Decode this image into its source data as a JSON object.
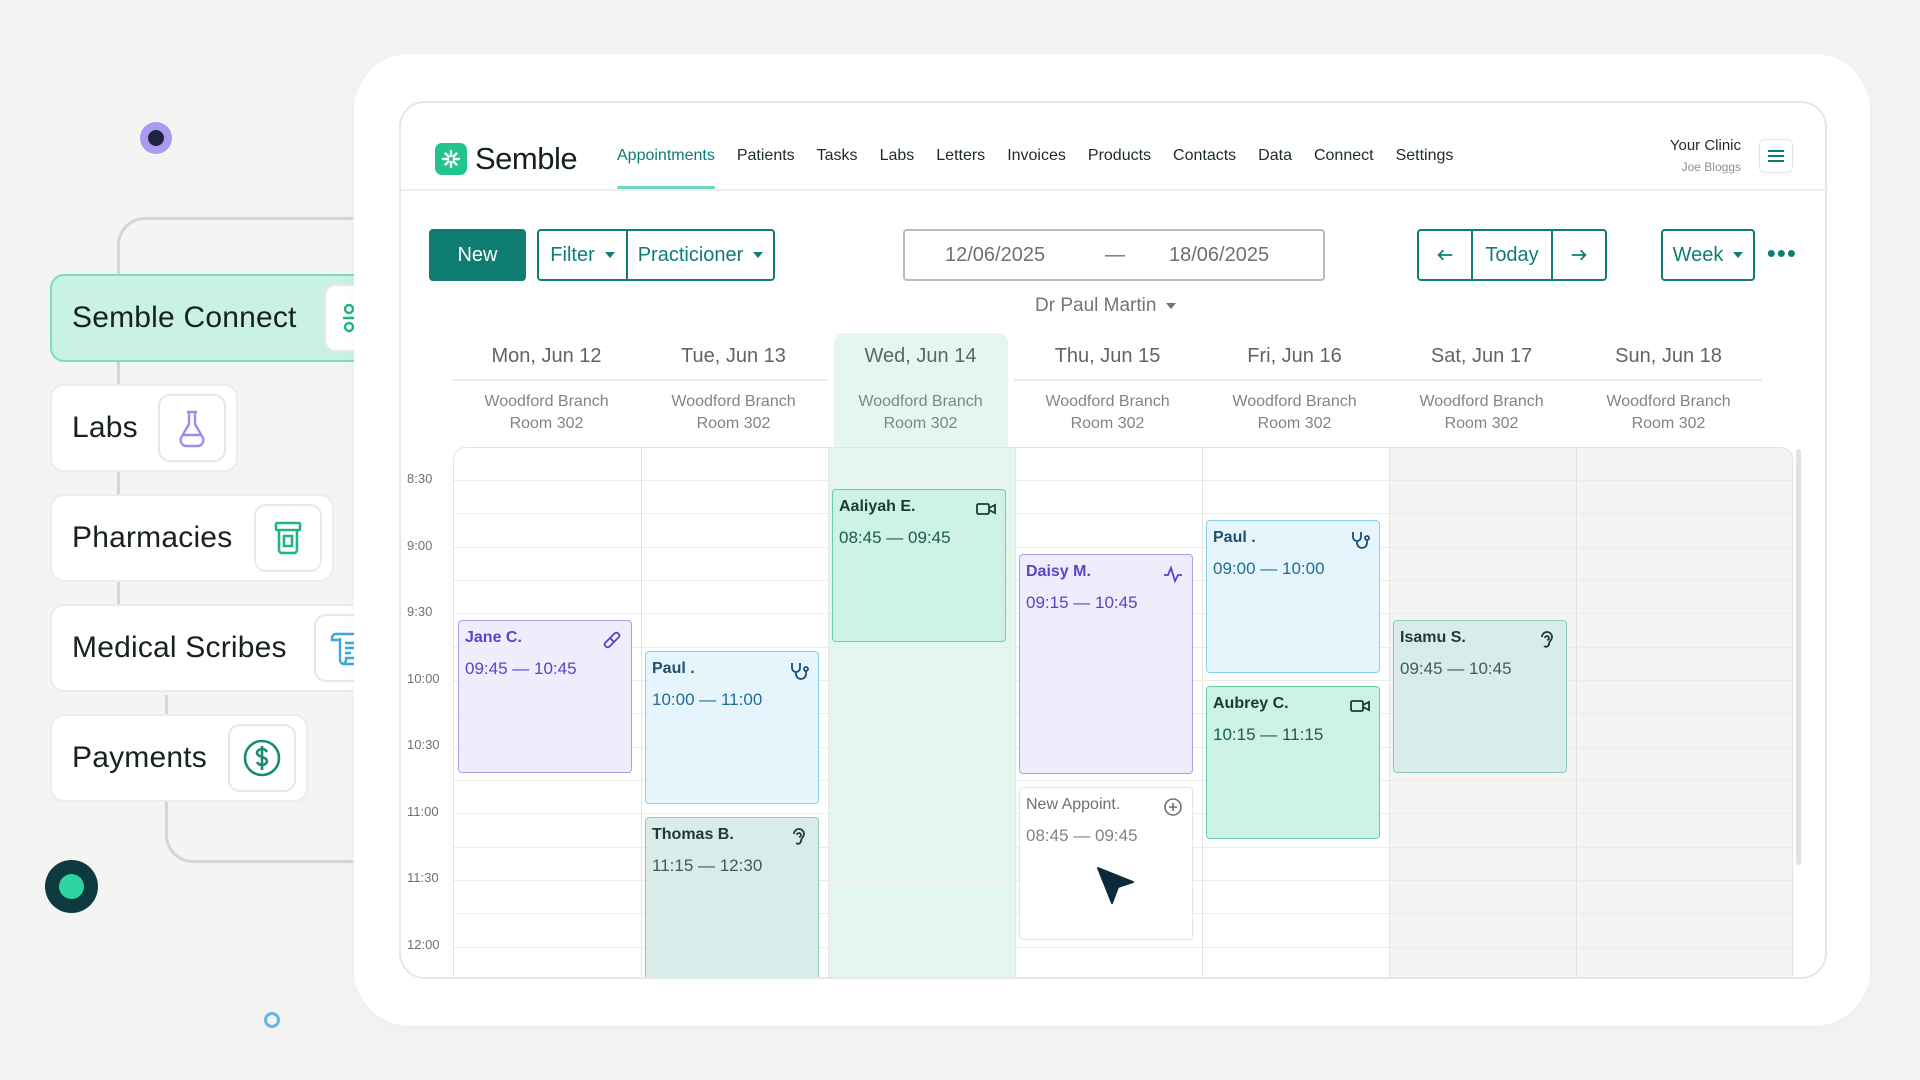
{
  "features": [
    {
      "label": "Semble Connect",
      "icon": "network-icon",
      "active": true
    },
    {
      "label": "Labs",
      "icon": "flask-icon"
    },
    {
      "label": "Pharmacies",
      "icon": "pill-bottle-icon"
    },
    {
      "label": "Medical Scribes",
      "icon": "scroll-icon"
    },
    {
      "label": "Payments",
      "icon": "dollar-coin-icon"
    }
  ],
  "brand": {
    "name": "Semble",
    "accent": "#0f7d72",
    "logo_color": "#21c48c"
  },
  "nav": [
    "Appointments",
    "Patients",
    "Tasks",
    "Labs",
    "Letters",
    "Invoices",
    "Products",
    "Contacts",
    "Data",
    "Connect",
    "Settings"
  ],
  "clinic": {
    "name": "Your Clinic",
    "user": "Joe Bloggs"
  },
  "toolbar": {
    "new_label": "New",
    "filter_label": "Filter",
    "practitioner_label": "Practicioner",
    "date_from": "12/06/2025",
    "date_sep": "—",
    "date_to": "18/06/2025",
    "today_label": "Today",
    "view_label": "Week",
    "more_label": "•••",
    "practitioner_name": "Dr Paul Martin"
  },
  "days": [
    {
      "label": "Mon, Jun 12",
      "branch": "Woodford Branch",
      "room": "Room 302"
    },
    {
      "label": "Tue, Jun 13",
      "branch": "Woodford Branch",
      "room": "Room 302"
    },
    {
      "label": "Wed, Jun 14",
      "branch": "Woodford Branch",
      "room": "Room 302"
    },
    {
      "label": "Thu, Jun 15",
      "branch": "Woodford Branch",
      "room": "Room 302"
    },
    {
      "label": "Fri, Jun 16",
      "branch": "Woodford Branch",
      "room": "Room 302"
    },
    {
      "label": "Sat, Jun 17",
      "branch": "Woodford Branch",
      "room": "Room 302"
    },
    {
      "label": "Sun, Jun 18",
      "branch": "Woodford Branch",
      "room": "Room 302"
    }
  ],
  "times": [
    "8:30",
    "9:00",
    "9:30",
    "10:00",
    "10:30",
    "11:00",
    "11:30",
    "12:00"
  ],
  "events": [
    {
      "name": "Jane C.",
      "time": "09:45 — 10:45",
      "style": "purple",
      "icon": "bandage-icon"
    },
    {
      "name": "Paul .",
      "time": "10:00 — 11:00",
      "style": "blue",
      "icon": "stethoscope-icon"
    },
    {
      "name": "Thomas B.",
      "time": "11:15 — 12:30",
      "style": "teal",
      "icon": "ear-icon"
    },
    {
      "name": "Aaliyah E.",
      "time": "08:45 — 09:45",
      "style": "green",
      "icon": "video-icon"
    },
    {
      "name": "Daisy M.",
      "time": "09:15 — 10:45",
      "style": "purple",
      "icon": "pulse-icon"
    },
    {
      "name": "New Appoint.",
      "time": "08:45 — 09:45",
      "style": "new",
      "icon": "plus-circle-icon"
    },
    {
      "name": "Paul .",
      "time": "09:00 — 10:00",
      "style": "blue",
      "icon": "stethoscope-icon"
    },
    {
      "name": "Aubrey C.",
      "time": "10:15 — 11:15",
      "style": "green",
      "icon": "video-icon"
    },
    {
      "name": "Isamu S.",
      "time": "09:45 — 10:45",
      "style": "teal",
      "icon": "ear-icon"
    }
  ]
}
